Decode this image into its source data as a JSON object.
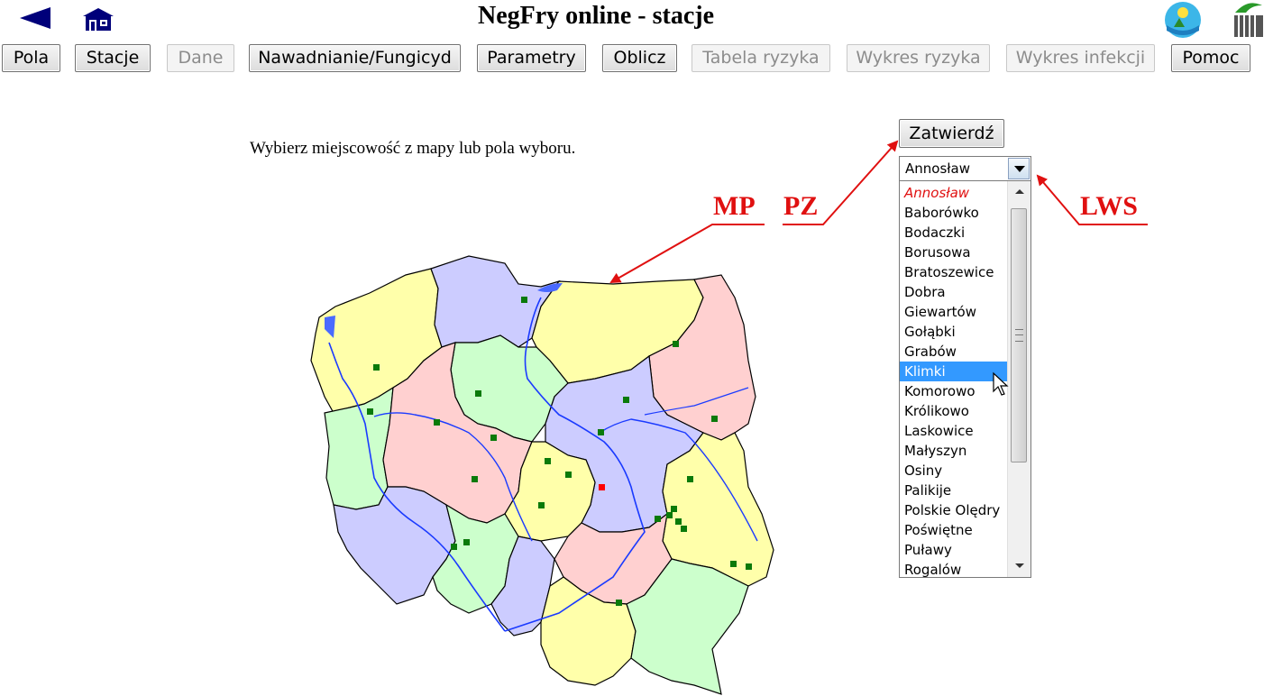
{
  "header": {
    "title": "NegFry online - stacje"
  },
  "nav": [
    {
      "label": "Pola",
      "enabled": true
    },
    {
      "label": "Stacje",
      "enabled": true
    },
    {
      "label": "Dane",
      "enabled": false
    },
    {
      "label": "Nawadnianie/Fungicyd",
      "enabled": true
    },
    {
      "label": "Parametry",
      "enabled": true
    },
    {
      "label": "Oblicz",
      "enabled": true
    },
    {
      "label": "Tabela ryzyka",
      "enabled": false
    },
    {
      "label": "Wykres ryzyka",
      "enabled": false
    },
    {
      "label": "Wykres infekcji",
      "enabled": false
    },
    {
      "label": "Pomoc",
      "enabled": true
    }
  ],
  "main": {
    "instruction": "Wybierz miejscowość z mapy lub pola wyboru.",
    "confirm_label": "Zatwierdź",
    "select_value": "Annosław",
    "list_items": [
      "Annosław",
      "Baborówko",
      "Bodaczki",
      "Borusowa",
      "Bratoszewice",
      "Dobra",
      "Giewartów",
      "Gołąbki",
      "Grabów",
      "Klimki",
      "Komorowo",
      "Królikowo",
      "Laskowice",
      "Małyszyn",
      "Osiny",
      "Palikije",
      "Polskie Olędry",
      "Poświętne",
      "Puławy",
      "Rogalów"
    ],
    "selected_item": "Klimki"
  },
  "annotations": {
    "mp": "MP",
    "pz": "PZ",
    "lws": "LWS"
  },
  "colors": {
    "annotation": "#e01010",
    "selected": "#3399ff",
    "station": "#0a7a0a",
    "active_station": "#ff0000",
    "region_yellow": "#ffffaa",
    "region_blue": "#ccccff",
    "region_pink": "#ffd0d0",
    "region_green": "#ccffcc",
    "river": "#1a3aff",
    "back_icon": "#00007a"
  }
}
